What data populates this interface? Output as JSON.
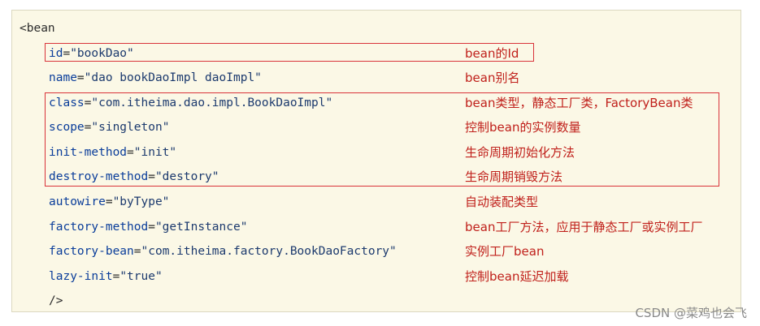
{
  "code": {
    "open_tag": "<bean",
    "close_tag": "/>",
    "lines": [
      {
        "attr": "id",
        "value": "\"bookDao\"",
        "desc": "bean的Id"
      },
      {
        "attr": "name",
        "value": "\"dao bookDaoImpl daoImpl\"",
        "desc": "bean别名"
      },
      {
        "attr": "class",
        "value": "\"com.itheima.dao.impl.BookDaoImpl\"",
        "desc": "bean类型，静态工厂类，FactoryBean类"
      },
      {
        "attr": "scope",
        "value": "\"singleton\"",
        "desc": "控制bean的实例数量"
      },
      {
        "attr": "init-method",
        "value": "\"init\"",
        "desc": "生命周期初始化方法"
      },
      {
        "attr": "destroy-method",
        "value": "\"destory\"",
        "desc": "生命周期销毁方法"
      },
      {
        "attr": "autowire",
        "value": "\"byType\"",
        "desc": "自动装配类型"
      },
      {
        "attr": "factory-method",
        "value": "\"getInstance\"",
        "desc": "bean工厂方法，应用于静态工厂或实例工厂"
      },
      {
        "attr": "factory-bean",
        "value": "\"com.itheima.factory.BookDaoFactory\"",
        "desc": "实例工厂bean"
      },
      {
        "attr": "lazy-init",
        "value": "\"true\"",
        "desc": "控制bean延迟加载"
      }
    ],
    "equals": "="
  },
  "colors": {
    "background": "#fbf8e6",
    "attribute": "#0a3d9a",
    "description": "#c0201b",
    "highlight_box": "#d9333a"
  },
  "watermark": "CSDN @菜鸡也会飞"
}
